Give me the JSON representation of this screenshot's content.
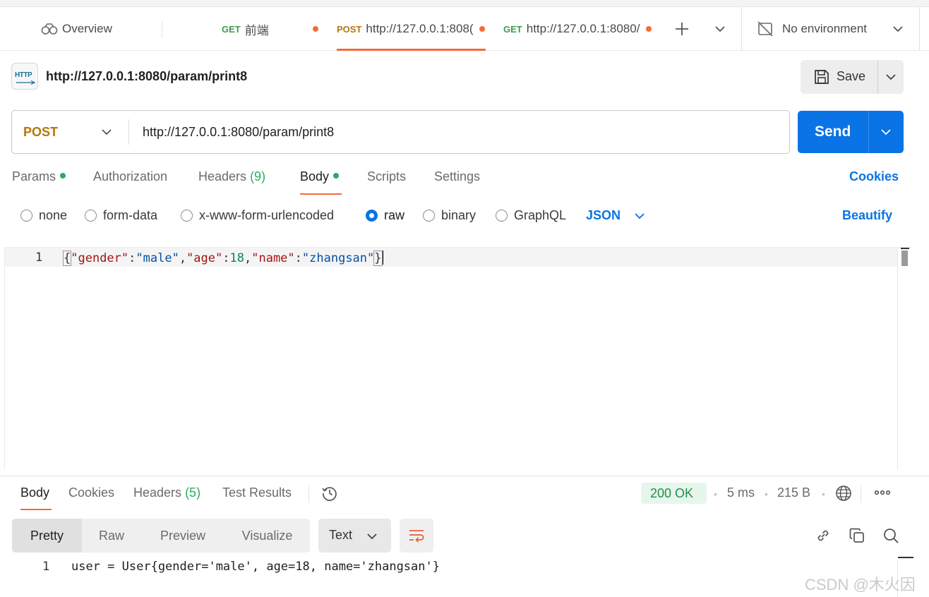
{
  "tabs": {
    "overview": "Overview",
    "tab1": {
      "method": "GET",
      "title": "前端"
    },
    "tab2": {
      "method": "POST",
      "title": "http://127.0.0.1:808("
    },
    "tab3": {
      "method": "GET",
      "title": "http://127.0.0.1:8080/"
    },
    "environment": "No environment"
  },
  "request": {
    "icon_text": "HTTP",
    "name": "http://127.0.0.1:8080/param/print8",
    "save_label": "Save",
    "method": "POST",
    "url": "http://127.0.0.1:8080/param/print8",
    "send_label": "Send"
  },
  "req_tabs": {
    "params": "Params",
    "authorization": "Authorization",
    "headers": "Headers",
    "headers_count": "(9)",
    "body": "Body",
    "scripts": "Scripts",
    "settings": "Settings",
    "cookies": "Cookies"
  },
  "body_types": {
    "none": "none",
    "form_data": "form-data",
    "urlencoded": "x-www-form-urlencoded",
    "raw": "raw",
    "binary": "binary",
    "graphql": "GraphQL",
    "language": "JSON",
    "beautify": "Beautify"
  },
  "editor": {
    "line_no": "1",
    "tokens": {
      "b_open": "{",
      "k1": "\"gender\"",
      "c1": ":",
      "v1": "\"male\"",
      "s1": ",",
      "k2": "\"age\"",
      "c2": ":",
      "v2": "18",
      "s2": ",",
      "k3": "\"name\"",
      "c3": ":",
      "v3": "\"zhangsan\"",
      "b_close": "}"
    }
  },
  "response": {
    "tabs": {
      "body": "Body",
      "cookies": "Cookies",
      "headers": "Headers",
      "headers_count": "(5)",
      "test_results": "Test Results"
    },
    "status": "200 OK",
    "time": "5 ms",
    "size": "215 B",
    "views": {
      "pretty": "Pretty",
      "raw": "Raw",
      "preview": "Preview",
      "visualize": "Visualize"
    },
    "format": "Text",
    "line_no": "1",
    "line": "user = User{gender='male', age=18, name='zhangsan'}"
  },
  "watermark": "CSDN @木火因",
  "colors": {
    "accent": "#0a73e6",
    "post": "#b5760b",
    "get": "#3f9b4c",
    "unsaved_dot": "#f26b3a",
    "status_ok": "#1f8f4a"
  }
}
